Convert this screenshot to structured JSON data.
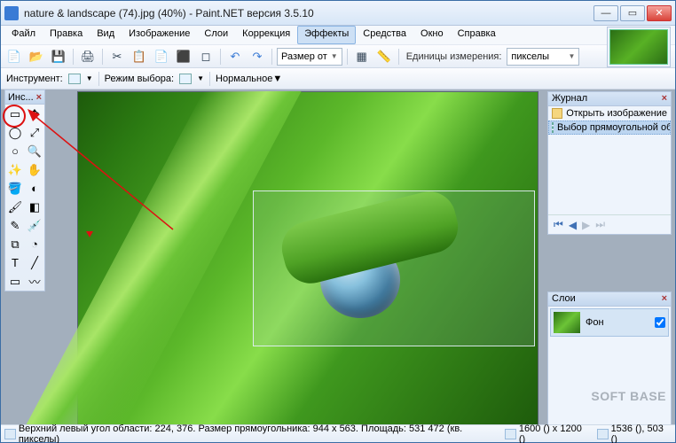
{
  "title": "nature & landscape (74).jpg (40%) - Paint.NET версия 3.5.10",
  "menu": {
    "file": "Файл",
    "edit": "Правка",
    "view": "Вид",
    "image": "Изображение",
    "layers": "Слои",
    "adjust": "Коррекция",
    "effects": "Эффекты",
    "tools": "Средства",
    "window": "Окно",
    "help": "Справка"
  },
  "toolbar": {
    "size_label": "Размер от",
    "units_label": "Единицы измерения:",
    "units_value": "пикселы"
  },
  "toolbar2": {
    "instrument": "Инструмент:",
    "mode_label": "Режим выбора:",
    "mode_value": "Нормальное"
  },
  "toolbox": {
    "title": "Инс..."
  },
  "history": {
    "title": "Журнал",
    "item_open": "Открыть изображение",
    "item_rect": "Выбор прямоугольной об..."
  },
  "layers": {
    "title": "Слои",
    "bg": "Фон"
  },
  "status": {
    "text": "Верхний левый угол области: 224, 376. Размер прямоугольника: 944 x 563. Площадь: 531 472 (кв. пикселы)",
    "dims": "1600 () x 1200 ()",
    "cursor": "1536 (), 503 ()"
  },
  "watermark": "SOFT    BASE"
}
